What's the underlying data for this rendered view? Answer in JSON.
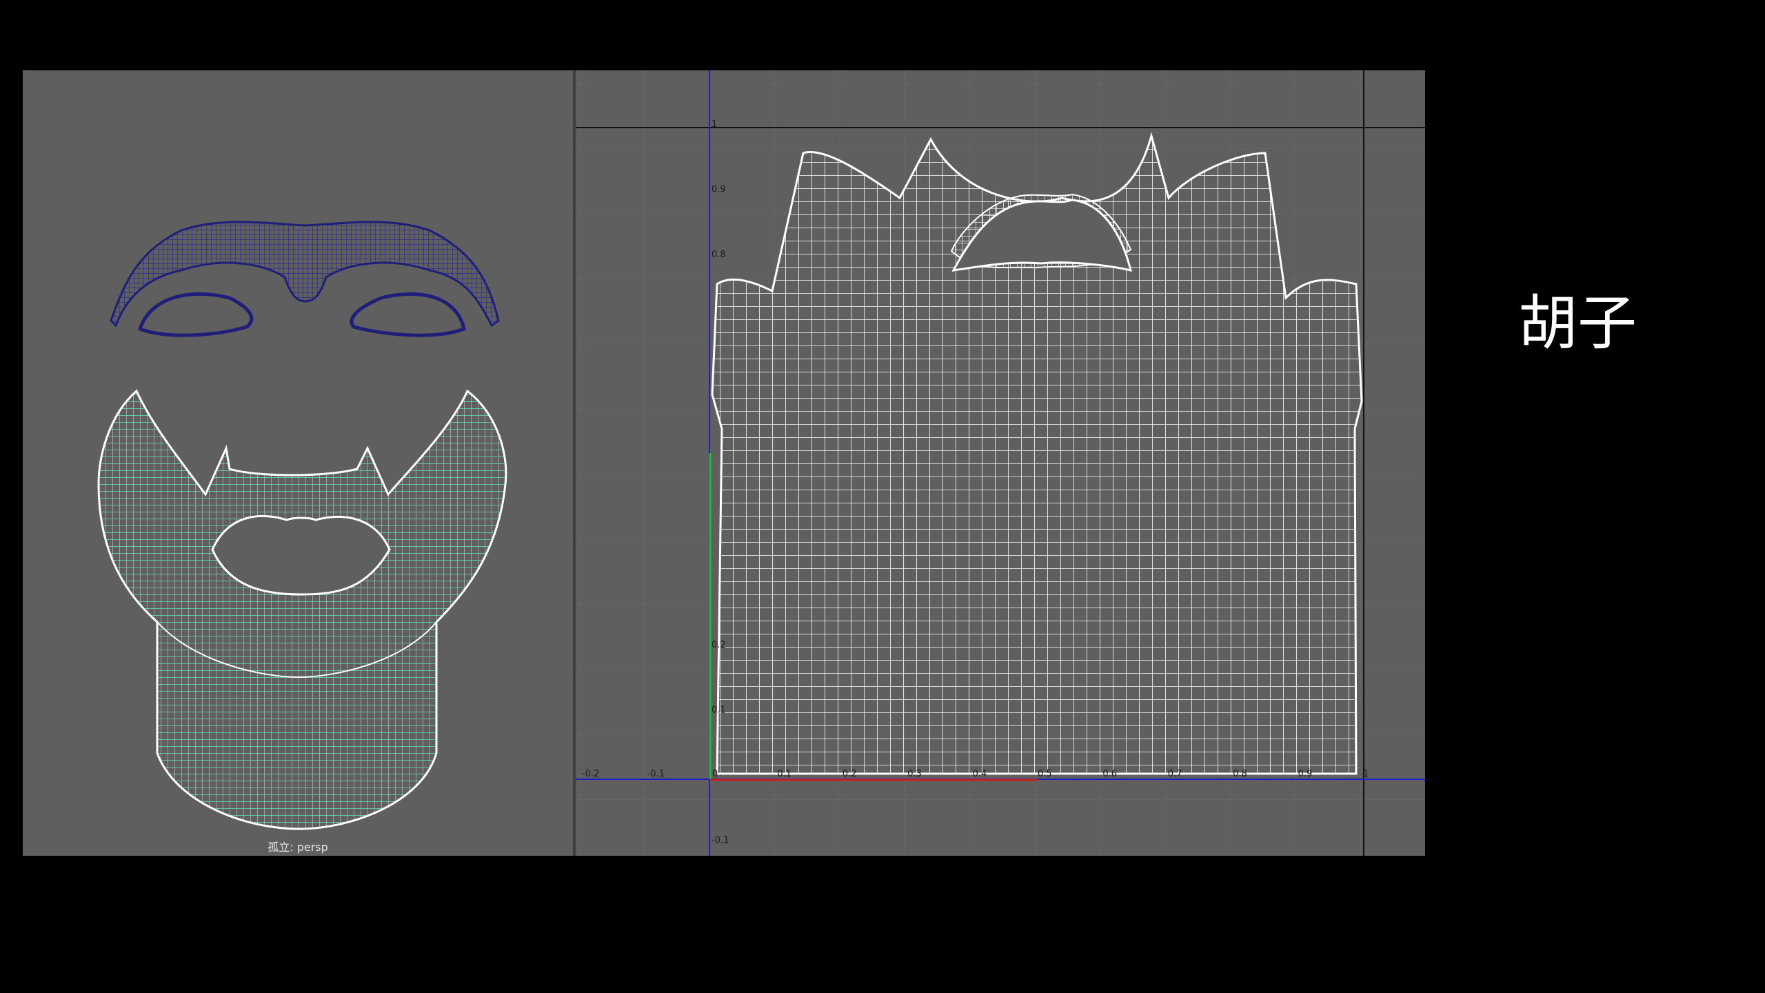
{
  "viewport_left": {
    "label": "孤立: persp",
    "models": [
      {
        "name": "eyebrow-mesh",
        "color": "#2b2b8c"
      },
      {
        "name": "beard-mesh",
        "color": "#5be3a6"
      }
    ]
  },
  "uv_editor": {
    "axis_x_ticks": [
      "-0.2",
      "-0.1",
      "0",
      "0.1",
      "0.2",
      "0.3",
      "0.4",
      "0.5",
      "0.6",
      "0.7",
      "0.8",
      "0.9",
      "1"
    ],
    "axis_y_ticks": [
      "1",
      "0.9",
      "0.8",
      "0.2",
      "0.1",
      "-0.1"
    ],
    "mesh_color": "#ffffff",
    "status_text": ""
  },
  "side": {
    "title": "",
    "label": "胡子"
  },
  "bottom": {
    "title": ""
  },
  "colors": {
    "viewport_bg": "#5f5f5f",
    "grid_line": "#6b6b6b",
    "axis_blue": "#2020c8",
    "axis_green": "#22c022",
    "axis_red": "#c82020"
  }
}
